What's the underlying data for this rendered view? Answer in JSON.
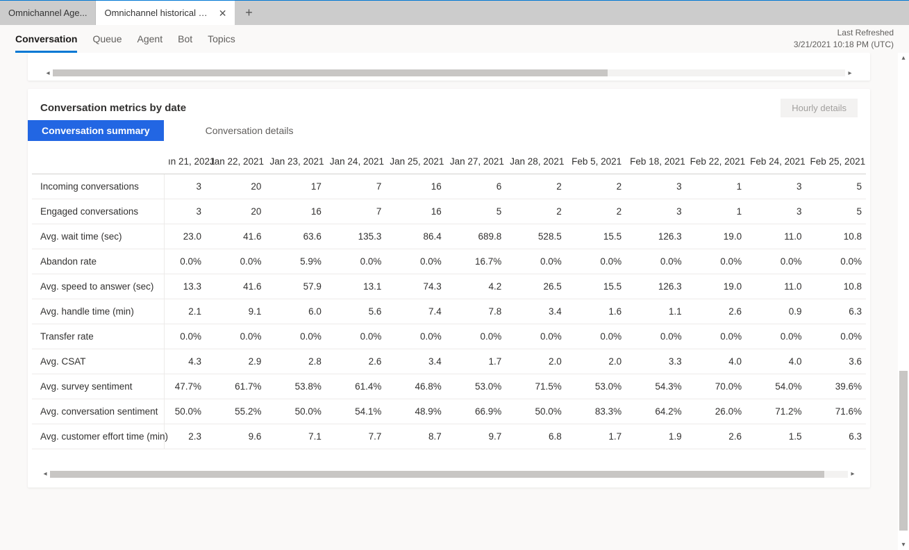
{
  "tabs": {
    "inactive": "Omnichannel Age...",
    "active": "Omnichannel historical an...",
    "close": "✕",
    "add": "+"
  },
  "nav": {
    "items": [
      "Conversation",
      "Queue",
      "Agent",
      "Bot",
      "Topics"
    ],
    "active_index": 0
  },
  "last_refreshed": {
    "label": "Last Refreshed",
    "value": "3/21/2021 10:18 PM (UTC)"
  },
  "metrics": {
    "title": "Conversation metrics by date",
    "hourly_btn": "Hourly details",
    "tabs": {
      "summary": "Conversation summary",
      "details": "Conversation details"
    },
    "columns": [
      "ın 21, 2021",
      "Jan 22, 2021",
      "Jan 23, 2021",
      "Jan 24, 2021",
      "Jan 25, 2021",
      "Jan 27, 2021",
      "Jan 28, 2021",
      "Feb 5, 2021",
      "Feb 18, 2021",
      "Feb 22, 2021",
      "Feb 24, 2021",
      "Feb 25, 2021"
    ],
    "rows": [
      {
        "label": "Incoming conversations",
        "values": [
          "3",
          "20",
          "17",
          "7",
          "16",
          "6",
          "2",
          "2",
          "3",
          "1",
          "3",
          "5"
        ]
      },
      {
        "label": "Engaged conversations",
        "values": [
          "3",
          "20",
          "16",
          "7",
          "16",
          "5",
          "2",
          "2",
          "3",
          "1",
          "3",
          "5"
        ]
      },
      {
        "label": "Avg. wait time (sec)",
        "values": [
          "23.0",
          "41.6",
          "63.6",
          "135.3",
          "86.4",
          "689.8",
          "528.5",
          "15.5",
          "126.3",
          "19.0",
          "11.0",
          "10.8"
        ]
      },
      {
        "label": "Abandon rate",
        "values": [
          "0.0%",
          "0.0%",
          "5.9%",
          "0.0%",
          "0.0%",
          "16.7%",
          "0.0%",
          "0.0%",
          "0.0%",
          "0.0%",
          "0.0%",
          "0.0%"
        ]
      },
      {
        "label": "Avg. speed to answer (sec)",
        "values": [
          "13.3",
          "41.6",
          "57.9",
          "13.1",
          "74.3",
          "4.2",
          "26.5",
          "15.5",
          "126.3",
          "19.0",
          "11.0",
          "10.8"
        ]
      },
      {
        "label": "Avg. handle time (min)",
        "values": [
          "2.1",
          "9.1",
          "6.0",
          "5.6",
          "7.4",
          "7.8",
          "3.4",
          "1.6",
          "1.1",
          "2.6",
          "0.9",
          "6.3"
        ]
      },
      {
        "label": "Transfer rate",
        "values": [
          "0.0%",
          "0.0%",
          "0.0%",
          "0.0%",
          "0.0%",
          "0.0%",
          "0.0%",
          "0.0%",
          "0.0%",
          "0.0%",
          "0.0%",
          "0.0%"
        ]
      },
      {
        "label": "Avg. CSAT",
        "values": [
          "4.3",
          "2.9",
          "2.8",
          "2.6",
          "3.4",
          "1.7",
          "2.0",
          "2.0",
          "3.3",
          "4.0",
          "4.0",
          "3.6"
        ]
      },
      {
        "label": "Avg. survey sentiment",
        "values": [
          "47.7%",
          "61.7%",
          "53.8%",
          "61.4%",
          "46.8%",
          "53.0%",
          "71.5%",
          "53.0%",
          "54.3%",
          "70.0%",
          "54.0%",
          "39.6%"
        ]
      },
      {
        "label": "Avg. conversation sentiment",
        "values": [
          "50.0%",
          "55.2%",
          "50.0%",
          "54.1%",
          "48.9%",
          "66.9%",
          "50.0%",
          "83.3%",
          "64.2%",
          "26.0%",
          "71.2%",
          "71.6%"
        ]
      },
      {
        "label": "Avg. customer effort time (min)",
        "values": [
          "2.3",
          "9.6",
          "7.1",
          "7.7",
          "8.7",
          "9.7",
          "6.8",
          "1.7",
          "1.9",
          "2.6",
          "1.5",
          "6.3"
        ]
      }
    ]
  }
}
